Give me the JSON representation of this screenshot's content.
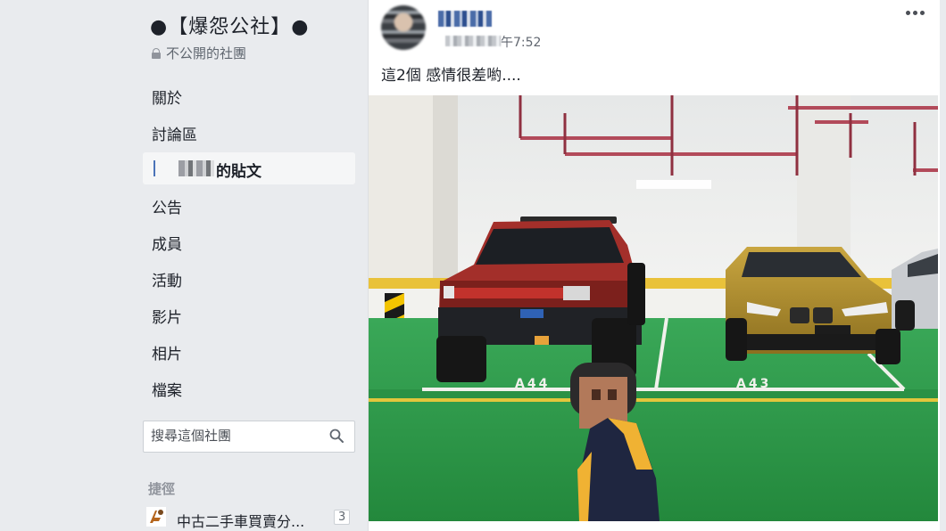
{
  "group": {
    "title": "●【爆怨公社】●",
    "privacy": "不公開的社團"
  },
  "nav": {
    "items": [
      {
        "label": "關於"
      },
      {
        "label": "討論區"
      },
      {
        "label": "的貼文"
      },
      {
        "label": "公告"
      },
      {
        "label": "成員"
      },
      {
        "label": "活動"
      },
      {
        "label": "影片"
      },
      {
        "label": "相片"
      },
      {
        "label": "檔案"
      }
    ]
  },
  "search": {
    "placeholder": "搜尋這個社團"
  },
  "shortcuts": {
    "heading": "捷徑",
    "items": [
      {
        "label": "中古二手車買賣分...",
        "count": "3"
      }
    ]
  },
  "post": {
    "time": "午7:52",
    "text": "這2個 感情很差喲....",
    "photo": {
      "spot_left_label": "A44",
      "spot_right_label": "A43"
    }
  },
  "colors": {
    "accent": "#4b73b8",
    "floor": "#2e9e4a",
    "stripe": "#f3c400"
  }
}
